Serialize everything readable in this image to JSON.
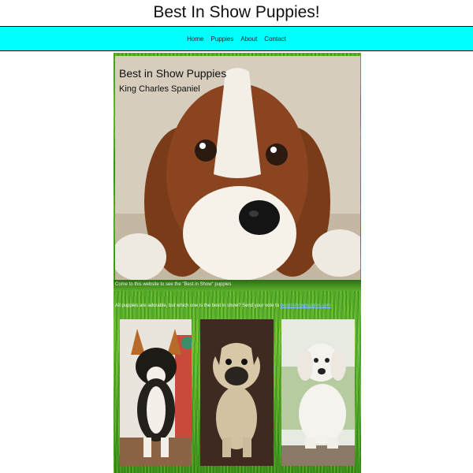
{
  "header": {
    "title": "Best In Show Puppies!"
  },
  "nav": {
    "items": [
      {
        "label": "Home"
      },
      {
        "label": "Puppies"
      },
      {
        "label": "About"
      },
      {
        "label": "Contact"
      }
    ]
  },
  "hero": {
    "heading": "Best in Show Puppies",
    "subheading": "King Charles Spaniel",
    "caption": "Come to this website to see the \"Best in Show\" puppies"
  },
  "intro": {
    "text": "All puppies are adorable, but which one is the best in show? Send your vote to",
    "link_text": "bestinshowpuppies.com"
  },
  "thumbnails": [
    {
      "icon": "corgi-puppy-photo"
    },
    {
      "icon": "pug-puppy-photo"
    },
    {
      "icon": "labrador-puppy-photo"
    }
  ],
  "colors": {
    "nav_background": "#00ffff",
    "grass_green": "#4aa423",
    "link_color": "#7ec8ff"
  }
}
